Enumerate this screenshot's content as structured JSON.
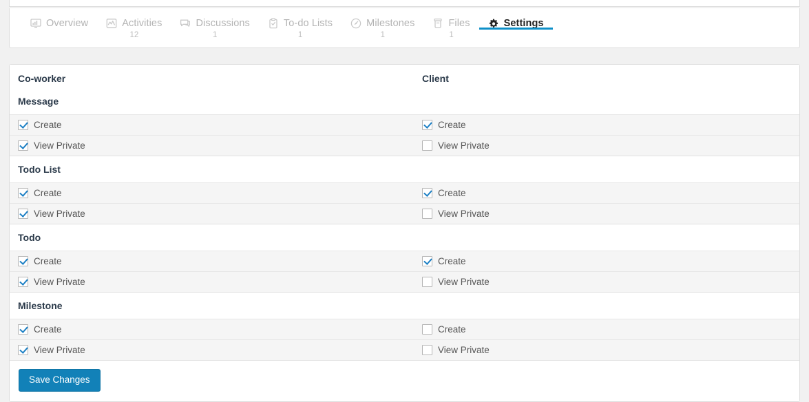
{
  "tabs": [
    {
      "label": "Overview",
      "count": "",
      "icon": "monitor-chart-icon",
      "active": false
    },
    {
      "label": "Activities",
      "count": "12",
      "icon": "activity-chart-icon",
      "active": false
    },
    {
      "label": "Discussions",
      "count": "1",
      "icon": "speech-bubble-icon",
      "active": false
    },
    {
      "label": "To-do Lists",
      "count": "1",
      "icon": "clipboard-check-icon",
      "active": false
    },
    {
      "label": "Milestones",
      "count": "1",
      "icon": "gauge-icon",
      "active": false
    },
    {
      "label": "Files",
      "count": "1",
      "icon": "archive-box-icon",
      "active": false
    },
    {
      "label": "Settings",
      "count": "",
      "icon": "gear-icon",
      "active": true
    }
  ],
  "permissions": {
    "columns": [
      {
        "key": "coworker",
        "label": "Co-worker"
      },
      {
        "key": "client",
        "label": "Client"
      }
    ],
    "sections": [
      {
        "title": "Message",
        "rows": [
          {
            "label": "Create",
            "coworker": true,
            "client": true
          },
          {
            "label": "View Private",
            "coworker": true,
            "client": false
          }
        ]
      },
      {
        "title": "Todo List",
        "rows": [
          {
            "label": "Create",
            "coworker": true,
            "client": true
          },
          {
            "label": "View Private",
            "coworker": true,
            "client": false
          }
        ]
      },
      {
        "title": "Todo",
        "rows": [
          {
            "label": "Create",
            "coworker": true,
            "client": true
          },
          {
            "label": "View Private",
            "coworker": true,
            "client": false
          }
        ]
      },
      {
        "title": "Milestone",
        "rows": [
          {
            "label": "Create",
            "coworker": true,
            "client": false
          },
          {
            "label": "View Private",
            "coworker": true,
            "client": false
          }
        ]
      }
    ]
  },
  "footer": {
    "save_label": "Save Changes"
  },
  "colors": {
    "accent": "#0e90c8",
    "button": "#1281b8",
    "checkmark": "#1b7fc4",
    "page_background": "#f1f1f1",
    "row_background": "#f5f5f5"
  }
}
